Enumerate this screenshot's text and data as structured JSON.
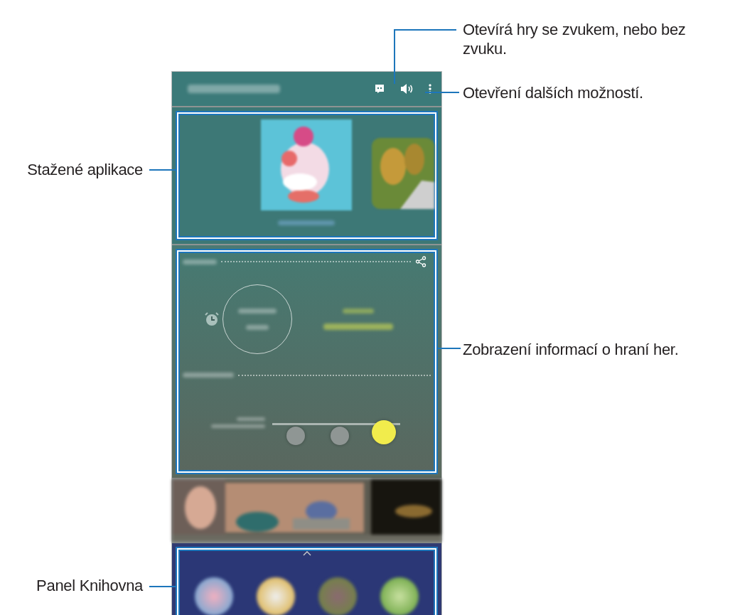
{
  "callouts": {
    "right": [
      "Otevírá hry se zvukem, nebo bez zvuku.",
      "Otevření dalších možností.",
      "Zobrazení informací o hraní her."
    ],
    "left": [
      "Stažené aplikace",
      "Panel Knihovna"
    ]
  },
  "phone": {
    "modes": [
      {
        "selected": false
      },
      {
        "selected": false
      },
      {
        "selected": true
      }
    ]
  }
}
